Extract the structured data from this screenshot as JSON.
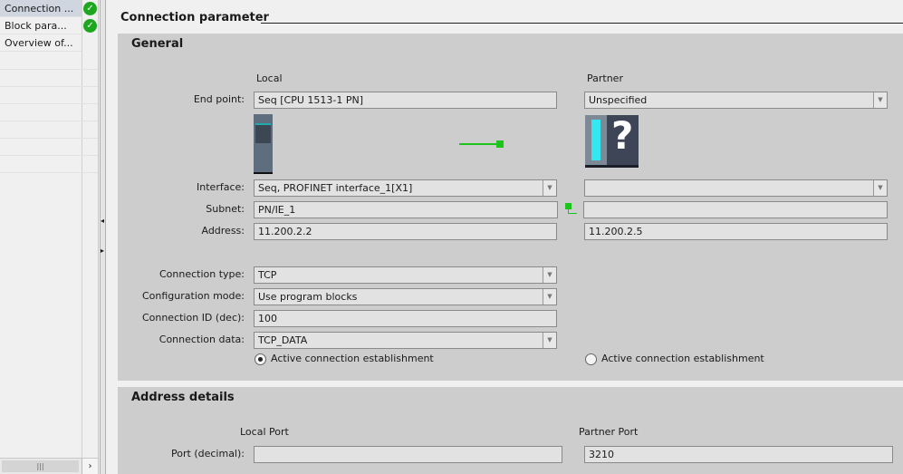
{
  "nav": {
    "items": [
      {
        "label": "Connection ...",
        "status": "ok",
        "selected": true
      },
      {
        "label": "Block para...",
        "status": "ok"
      },
      {
        "label": "Overview of..."
      }
    ]
  },
  "header": {
    "title": "Connection parameter"
  },
  "general": {
    "title": "General",
    "local_heading": "Local",
    "partner_heading": "Partner",
    "end_point": {
      "label": "End point:",
      "local": "Seq [CPU 1513-1 PN]",
      "partner": "Unspecified"
    },
    "interface": {
      "label": "Interface:",
      "local": "Seq, PROFINET interface_1[X1]",
      "partner": ""
    },
    "subnet": {
      "label": "Subnet:",
      "local": "PN/IE_1",
      "partner": ""
    },
    "address": {
      "label": "Address:",
      "local": "11.200.2.2",
      "partner": "11.200.2.5"
    },
    "connection_type": {
      "label": "Connection type:",
      "value": "TCP"
    },
    "configuration_mode": {
      "label": "Configuration mode:",
      "value": "Use program blocks"
    },
    "connection_id": {
      "label": "Connection ID (dec):",
      "value": "100"
    },
    "connection_data": {
      "label": "Connection data:",
      "value": "TCP_DATA"
    },
    "local_active": {
      "label": "Active connection establishment",
      "checked": true
    },
    "partner_active": {
      "label": "Active connection establishment",
      "checked": false
    }
  },
  "address_details": {
    "title": "Address details",
    "local_port_heading": "Local Port",
    "partner_port_heading": "Partner Port",
    "port_label": "Port (decimal):",
    "local_port": "",
    "partner_port": "3210"
  },
  "colors": {
    "accent_green": "#1ec41e",
    "panel": "#cdcdcd"
  }
}
